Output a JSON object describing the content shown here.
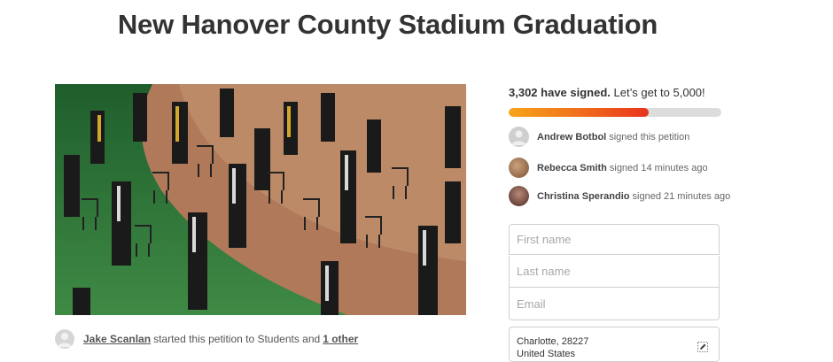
{
  "page": {
    "title": "New Hanover County Stadium Graduation"
  },
  "starter": {
    "name": "Jake Scanlan",
    "middle": "started this petition to Students and",
    "other": "1 other"
  },
  "progress": {
    "signed_count": "3,302 have signed.",
    "goal_text": "Let’s get to 5,000!",
    "fraction": 0.66
  },
  "signers": [
    {
      "name": "Andrew Botbol",
      "action": "signed this petition",
      "avatar": "default-avatar"
    },
    {
      "name": "Rebecca Smith",
      "action": "signed 14 minutes ago",
      "avatar": "photo-avatar"
    },
    {
      "name": "Christina Sperandio",
      "action": "signed 21 minutes ago",
      "avatar": "photo-avatar"
    }
  ],
  "form": {
    "first_name_placeholder": "First name",
    "last_name_placeholder": "Last name",
    "email_placeholder": "Email",
    "location_line1": "Charlotte, 28227",
    "location_line2": "United States"
  },
  "icons": {
    "edit": "edit-location-icon",
    "avatar": "user-avatar-icon"
  },
  "colors": {
    "bar_start": "#f7a41a",
    "bar_end": "#e8331e",
    "bar_track": "#dcdcdc"
  }
}
